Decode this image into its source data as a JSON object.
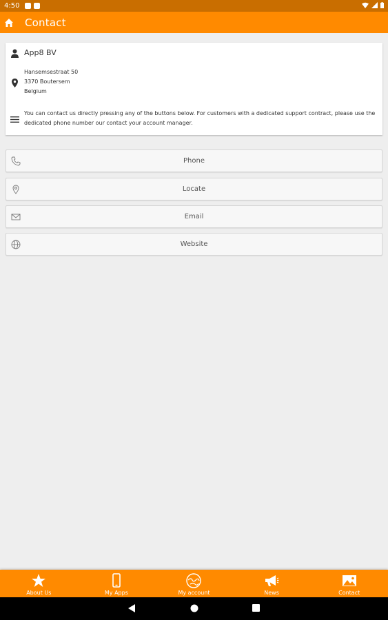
{
  "status_bar": {
    "time": "4:50"
  },
  "app_bar": {
    "title": "Contact"
  },
  "info": {
    "company": "App8 BV",
    "address_lines": [
      "Hansemsestraat 50",
      "3370 Boutersem",
      "Belgium"
    ],
    "description": "You can contact us directly pressing any of the buttons below. For customers with a dedicated support contract, please use the dedicated phone number our contact your account manager."
  },
  "actions": [
    {
      "label": "Phone",
      "icon": "phone-icon"
    },
    {
      "label": "Locate",
      "icon": "location-icon"
    },
    {
      "label": "Email",
      "icon": "mail-icon"
    },
    {
      "label": "Website",
      "icon": "globe-icon"
    }
  ],
  "bottom_nav": [
    {
      "label": "About Us",
      "icon": "star-icon"
    },
    {
      "label": "My Apps",
      "icon": "phone-device-icon"
    },
    {
      "label": "My account",
      "icon": "globe-account-icon"
    },
    {
      "label": "News",
      "icon": "megaphone-icon"
    },
    {
      "label": "Contact",
      "icon": "picture-icon"
    }
  ],
  "colors": {
    "accent": "#ff8a00",
    "status_bar": "#c96e00",
    "background": "#eeeeee"
  }
}
